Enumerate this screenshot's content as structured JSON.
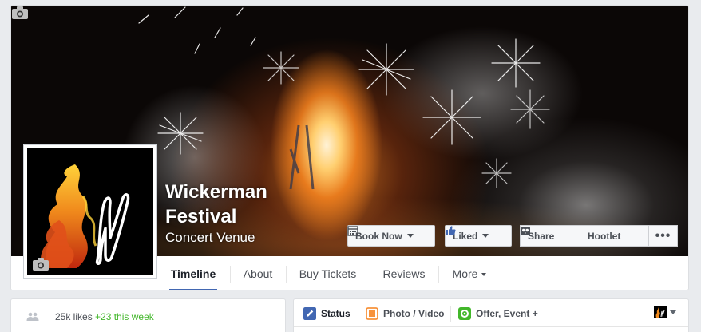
{
  "page": {
    "name": "Wickerman\nFestival",
    "category": "Concert Venue"
  },
  "actions": {
    "book_now": "Book Now",
    "liked": "Liked",
    "share": "Share",
    "hootlet": "Hootlet",
    "more": "•••"
  },
  "tabs": [
    {
      "label": "Timeline",
      "active": true
    },
    {
      "label": "About"
    },
    {
      "label": "Buy Tickets"
    },
    {
      "label": "Reviews"
    },
    {
      "label": "More"
    }
  ],
  "likes": {
    "count": "25k likes",
    "this_week": "+23 this week"
  },
  "composer": {
    "tabs": [
      {
        "label": "Status",
        "icon": "pencil-icon",
        "color": "#4267b2"
      },
      {
        "label": "Photo / Video",
        "icon": "photo-icon",
        "color": "#f7923b"
      },
      {
        "label": "Offer, Event +",
        "icon": "gear-icon",
        "color": "#42b72a"
      }
    ]
  },
  "colors": {
    "accent": "#4267b2",
    "positive": "#42b72a"
  }
}
